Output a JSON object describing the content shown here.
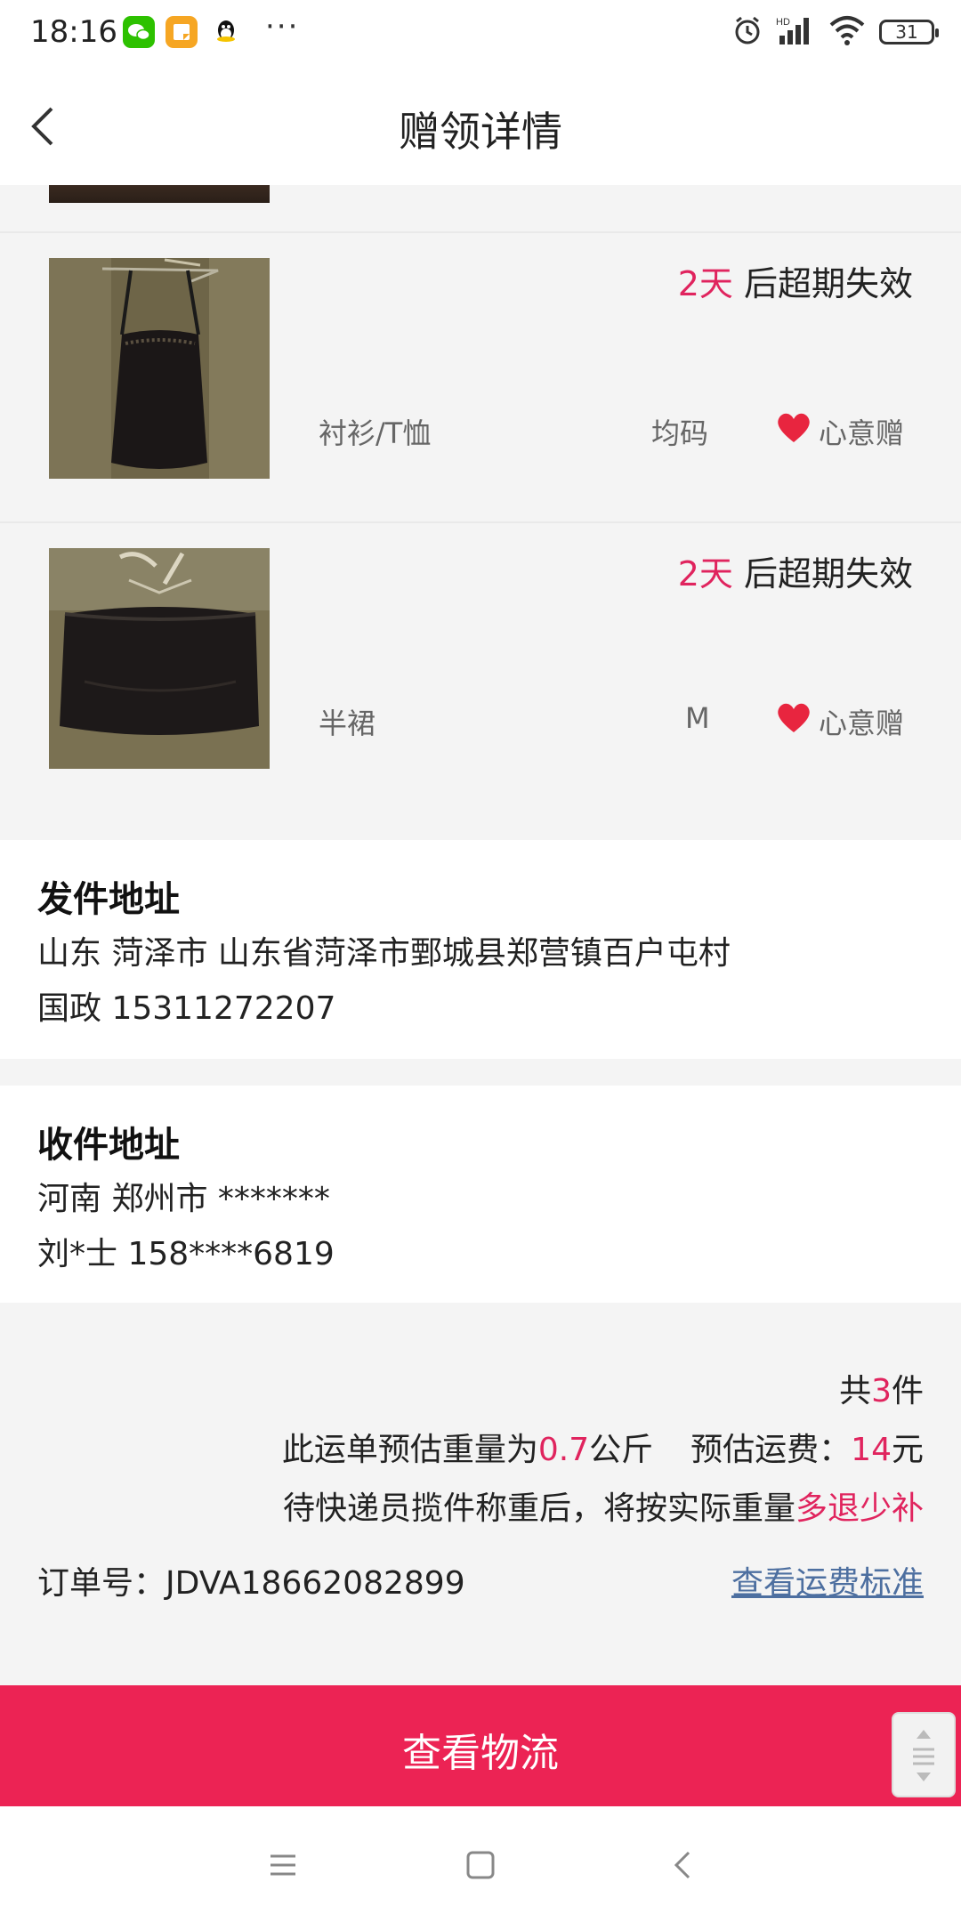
{
  "status_bar": {
    "time": "18:16",
    "apps": [
      "wechat-icon",
      "notes-icon",
      "qq-icon"
    ],
    "more": "···",
    "battery": "31"
  },
  "header": {
    "title": "赠领详情"
  },
  "items": [
    {
      "expiry_days": "2天",
      "expiry_text": " 后超期失效",
      "category": "衬衫/T恤",
      "size": "均码",
      "gift_label": "心意赠",
      "image_icon": "camisole-photo"
    },
    {
      "expiry_days": "2天",
      "expiry_text": " 后超期失效",
      "category": "半裙",
      "size": "M",
      "gift_label": "心意赠",
      "image_icon": "skirt-photo"
    }
  ],
  "sender": {
    "title": "发件地址",
    "address": "山东 菏泽市 山东省菏泽市鄄城县郑营镇百户屯村",
    "contact": "国政 15311272207"
  },
  "receiver": {
    "title": "收件地址",
    "address": "河南 郑州市 *******",
    "contact": "刘*士 158****6819"
  },
  "summary": {
    "total_prefix": "共",
    "total_count": "3",
    "total_suffix": "件",
    "weight_prefix": "此运单预估重量为",
    "weight_value": "0.7",
    "weight_unit": "公斤",
    "fee_prefix": "预估运费：",
    "fee_value": "14",
    "fee_unit": "元",
    "note_prefix": "待快递员揽件称重后，将按实际重量",
    "note_highlight": "多退少补",
    "order_label": "订单号：JDVA18662082899",
    "fee_standard_link": "查看运费标准"
  },
  "actions": {
    "logistics_button": "查看物流"
  },
  "colors": {
    "accent": "#e0245e",
    "button": "#ec2354",
    "link": "#4d6fa0"
  }
}
